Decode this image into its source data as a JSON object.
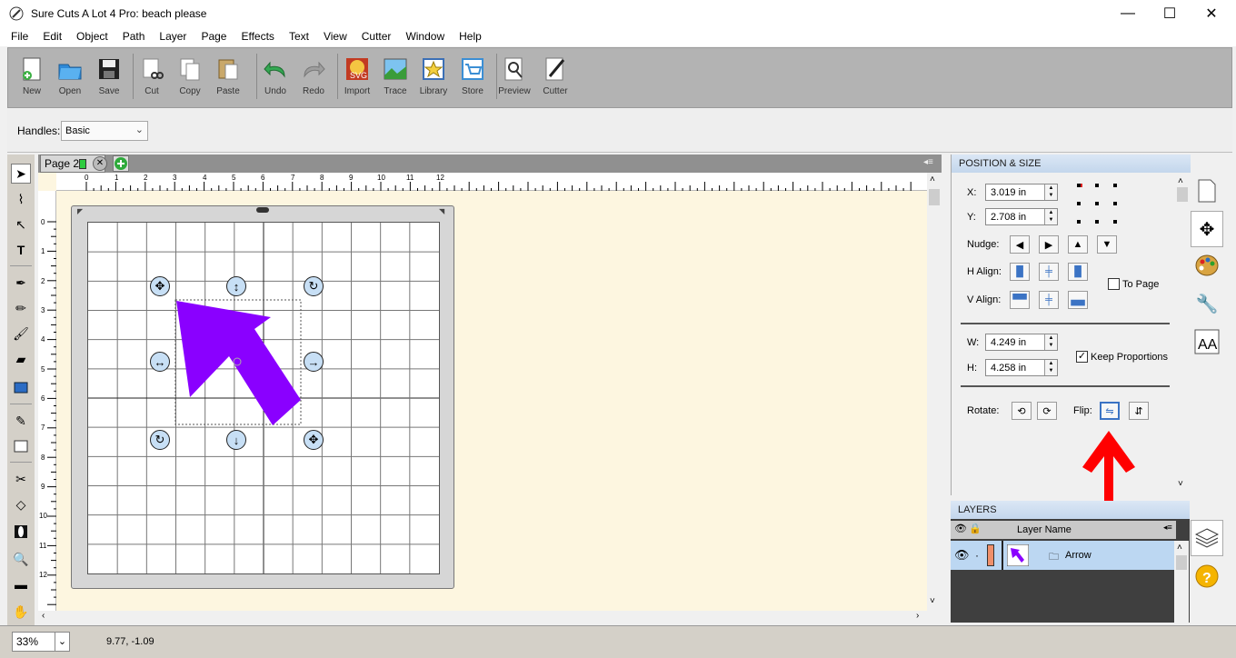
{
  "window": {
    "title": "Sure Cuts A Lot 4 Pro: beach please",
    "minimize": "—",
    "maximize": "☐",
    "close": "✕"
  },
  "menu": [
    "File",
    "Edit",
    "Object",
    "Path",
    "Layer",
    "Page",
    "Effects",
    "Text",
    "View",
    "Cutter",
    "Window",
    "Help"
  ],
  "toolbar": {
    "new": "New",
    "open": "Open",
    "save": "Save",
    "cut": "Cut",
    "copy": "Copy",
    "paste": "Paste",
    "undo": "Undo",
    "redo": "Redo",
    "import": "Import",
    "trace": "Trace",
    "library": "Library",
    "store": "Store",
    "preview": "Preview",
    "cutter": "Cutter"
  },
  "handles": {
    "label": "Handles:",
    "value": "Basic"
  },
  "page_tab": {
    "label": "Page 2"
  },
  "rulers": {
    "h": [
      "0",
      "1",
      "2",
      "3",
      "4",
      "5",
      "6",
      "7",
      "8",
      "9",
      "10",
      "11",
      "12"
    ],
    "v": [
      "0",
      "1",
      "2",
      "3",
      "4",
      "5",
      "6",
      "7",
      "8",
      "9",
      "10",
      "11",
      "12"
    ]
  },
  "position_size": {
    "header": "POSITION & SIZE",
    "x_label": "X:",
    "x_value": "3.019 in",
    "y_label": "Y:",
    "y_value": "2.708 in",
    "nudge_label": "Nudge:",
    "halign_label": "H Align:",
    "valign_label": "V Align:",
    "to_page_label": "To Page",
    "to_page_checked": false,
    "w_label": "W:",
    "w_value": "4.249 in",
    "h_label": "H:",
    "h_value": "4.258 in",
    "keep_proportions_label": "Keep Proportions",
    "keep_proportions_checked": true,
    "rotate_label": "Rotate:",
    "flip_label": "Flip:"
  },
  "layers": {
    "header": "LAYERS",
    "col_name": "Layer Name",
    "rows": [
      {
        "name": "Arrow",
        "color": "#ef8f6a"
      }
    ]
  },
  "status": {
    "zoom": "33%",
    "coords": "9.77, -1.09"
  },
  "colors": {
    "shape": "#8a00ff",
    "annotation_arrow": "#ff0000",
    "handle_fill": "#c7dff5",
    "canvas_bg": "#fdf6e0"
  }
}
